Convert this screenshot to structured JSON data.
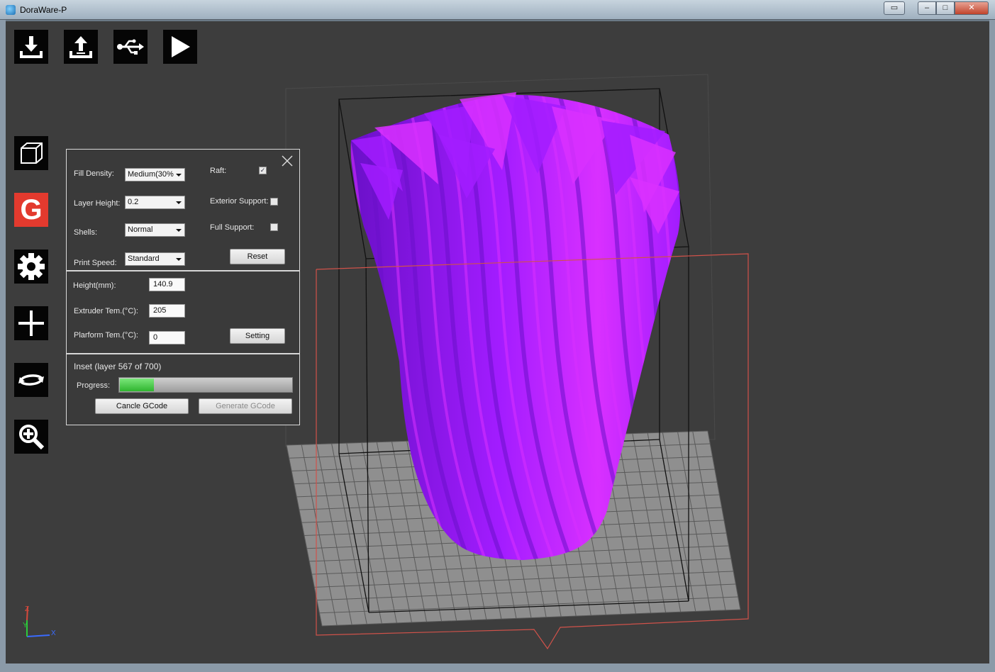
{
  "window": {
    "title": "DoraWare-P",
    "restore_glyph": "▭",
    "min_glyph": "–",
    "max_glyph": "□",
    "close_glyph": "✕"
  },
  "toolbar_top": [
    {
      "name": "load-model",
      "icon": "download-tray-icon"
    },
    {
      "name": "export",
      "icon": "upload-tray-icon"
    },
    {
      "name": "usb-connect",
      "icon": "usb-icon"
    },
    {
      "name": "start-print",
      "icon": "play-icon"
    }
  ],
  "toolbar_side": [
    {
      "name": "view-cube",
      "icon": "cube-icon"
    },
    {
      "name": "gcode",
      "icon": "g-letter-icon",
      "label": "G"
    },
    {
      "name": "settings",
      "icon": "gear-icon"
    },
    {
      "name": "move",
      "icon": "plus-move-icon"
    },
    {
      "name": "rotate",
      "icon": "rotate-icon"
    },
    {
      "name": "zoom",
      "icon": "zoom-in-icon"
    }
  ],
  "panel": {
    "fill_density_label": "Fill Density:",
    "fill_density_value": "Medium(30%",
    "layer_height_label": "Layer Height:",
    "layer_height_value": "0.2",
    "shells_label": "Shells:",
    "shells_value": "Normal",
    "print_speed_label": "Print Speed:",
    "print_speed_value": "Standard",
    "raft_label": "Raft:",
    "raft_checked": true,
    "exterior_support_label": "Exterior Support:",
    "exterior_support_checked": false,
    "full_support_label": "Full Support:",
    "full_support_checked": false,
    "reset_label": "Reset",
    "height_label": "Height(mm):",
    "height_value": "140.9",
    "extruder_label": "Extruder Tem.(°C):",
    "extruder_value": "205",
    "platform_label": "Plarform Tem.(°C):",
    "platform_value": "0",
    "setting_label": "Setting",
    "status_text": "Inset (layer 567 of 700)",
    "progress_label": "Progress:",
    "progress_fraction": 0.2,
    "cancel_label": "Cancle GCode",
    "generate_label": "Generate GCode"
  },
  "axes": {
    "x": "X",
    "y": "Y",
    "z": "Z"
  },
  "colors": {
    "model": "#a21cff",
    "model_light": "#d930ff",
    "model_dark": "#6a10c8",
    "bed": "#8f8f8f",
    "bed_grid": "#5a5a5a",
    "build_box": "#111111",
    "slice_plane": "#d0524a",
    "viewport_bg": "#3d3d3d",
    "gcode_tool": "#e33a2e",
    "progress": "#2fb52f"
  }
}
